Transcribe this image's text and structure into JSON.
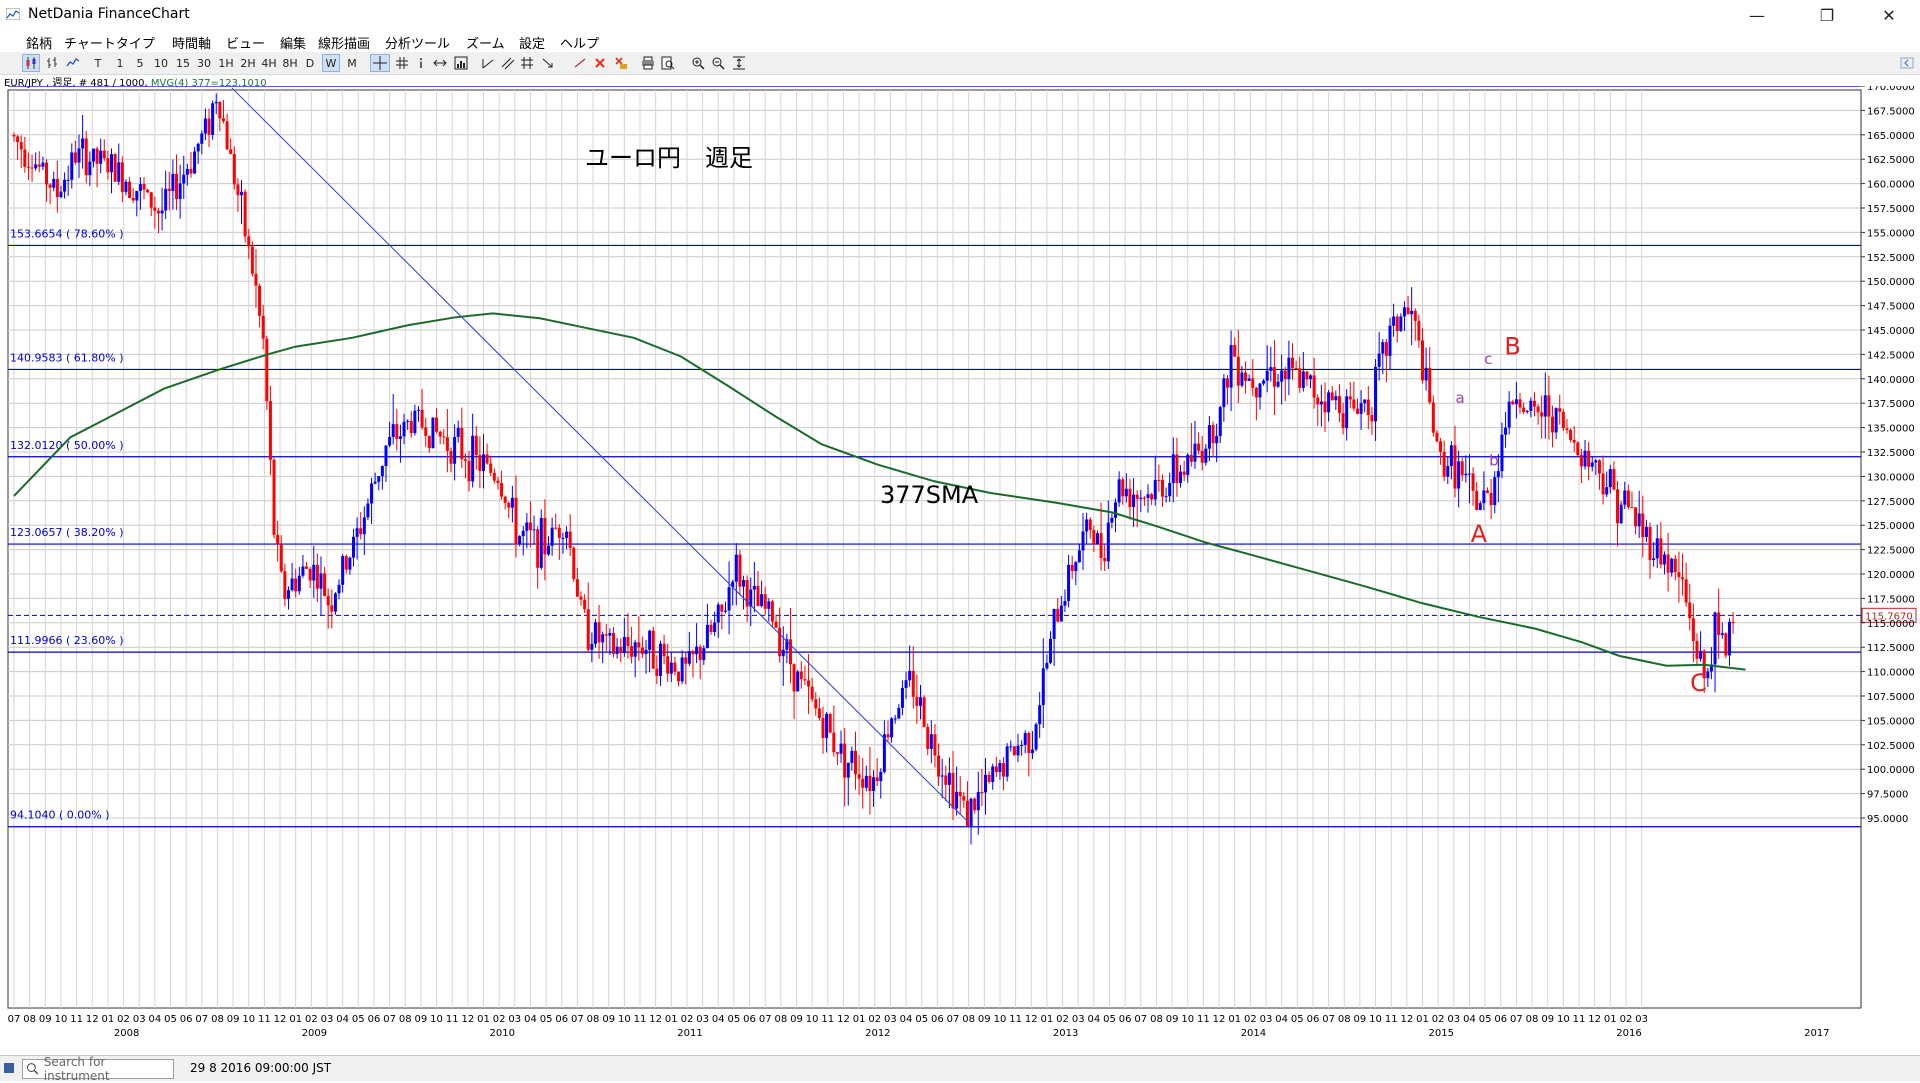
{
  "window": {
    "title": "NetDania FinanceChart",
    "minimize": "—",
    "maximize": "❐",
    "close": "✕"
  },
  "menu": [
    "銘柄",
    "チャートタイプ",
    "時間軸",
    "ビュー",
    "編集",
    "線形描画",
    "分析ツール",
    "ズーム",
    "設定",
    "ヘルプ"
  ],
  "toolbar": {
    "periods": [
      "T",
      "1",
      "5",
      "10",
      "15",
      "30",
      "1H",
      "2H",
      "4H",
      "8H",
      "D",
      "W",
      "M"
    ],
    "selected_period": "W"
  },
  "info": {
    "symbol_line": "EUR/JPY , 週足, # 481 / 1000,",
    "mvg_line": "MVG(4) 377=123.1010"
  },
  "status": {
    "search_placeholder": "Search for instrument",
    "datetime": "29 8 2016 09:00:00 JST"
  },
  "colors": {
    "up_candle": "#0000ff",
    "down_candle": "#ff0000",
    "sma": "#1a6b2a",
    "fib_lines": "#0000cc",
    "annotation_red": "#e02020",
    "annotation_purple": "#a040b0"
  },
  "chart_data": {
    "type": "candlestick",
    "instrument": "EUR/JPY",
    "timeframe": "週足",
    "annotation_title": "ユーロ円　週足",
    "sma_label": "377SMA",
    "y_axis": {
      "ylim": [
        94.5,
        171.0
      ],
      "ticks": [
        "170.0000",
        "167.5000",
        "165.0000",
        "162.5000",
        "160.0000",
        "157.5000",
        "155.0000",
        "152.5000",
        "150.0000",
        "147.5000",
        "145.0000",
        "142.5000",
        "140.0000",
        "137.5000",
        "135.0000",
        "132.5000",
        "130.0000",
        "127.5000",
        "125.0000",
        "122.5000",
        "120.0000",
        "117.5000",
        "115.0000",
        "112.5000",
        "110.0000",
        "107.5000",
        "105.0000",
        "102.5000",
        "100.0000",
        "97.5000",
        "95.0000"
      ]
    },
    "current_price": "115.7670",
    "current_value": 115.767,
    "fibonacci_levels": [
      {
        "value": 170.0,
        "label": ""
      },
      {
        "value": 153.6654,
        "label": "153.6654 ( 78.60% )"
      },
      {
        "value": 140.9583,
        "label": "140.9583 ( 61.80% )"
      },
      {
        "value": 132.012,
        "label": "132.0120 ( 50.00% )"
      },
      {
        "value": 123.0657,
        "label": "123.0657 ( 38.20% )"
      },
      {
        "value": 111.9966,
        "label": "111.9966 ( 23.60% )"
      },
      {
        "value": 94.104,
        "label": "94.1040 ( 0.00% )"
      }
    ],
    "x_axis": {
      "start": 2008.0,
      "end": 2017.25,
      "months": [
        "07",
        "08",
        "09",
        "10",
        "11",
        "12",
        "01",
        "02",
        "03",
        "04",
        "05",
        "06",
        "07",
        "08",
        "09",
        "10",
        "11",
        "12",
        "01",
        "02",
        "03",
        "04",
        "05",
        "06",
        "07",
        "08",
        "09",
        "10",
        "11",
        "12",
        "01",
        "02",
        "03",
        "04",
        "05",
        "06",
        "07",
        "08",
        "09",
        "10",
        "11",
        "12",
        "01",
        "02",
        "03",
        "04",
        "05",
        "06",
        "07",
        "08",
        "09",
        "10",
        "11",
        "12",
        "01",
        "02",
        "03",
        "04",
        "05",
        "06",
        "07",
        "08",
        "09",
        "10",
        "11",
        "12",
        "01",
        "02",
        "03",
        "04",
        "05",
        "06",
        "07",
        "08",
        "09",
        "10",
        "11",
        "12",
        "01",
        "02",
        "03",
        "04",
        "05",
        "06",
        "07",
        "08",
        "09",
        "10",
        "11",
        "12",
        "01",
        "02",
        "03",
        "04",
        "05",
        "06",
        "07",
        "08",
        "09",
        "10",
        "11",
        "12",
        "01",
        "02",
        "03"
      ],
      "years": [
        "2008",
        "2009",
        "2010",
        "2011",
        "2012",
        "2013",
        "2014",
        "2015",
        "2016",
        "2017"
      ]
    },
    "price_path": [
      [
        2007.5,
        165
      ],
      [
        2007.6,
        163
      ],
      [
        2007.75,
        159
      ],
      [
        2007.85,
        163
      ],
      [
        2008.0,
        162
      ],
      [
        2008.15,
        160
      ],
      [
        2008.3,
        157
      ],
      [
        2008.45,
        162
      ],
      [
        2008.55,
        166
      ],
      [
        2008.6,
        169.5
      ],
      [
        2008.7,
        160
      ],
      [
        2008.8,
        150
      ],
      [
        2008.85,
        143
      ],
      [
        2008.9,
        125
      ],
      [
        2008.95,
        118
      ],
      [
        2009.1,
        121
      ],
      [
        2009.2,
        117
      ],
      [
        2009.35,
        124
      ],
      [
        2009.5,
        133
      ],
      [
        2009.65,
        136
      ],
      [
        2009.8,
        134
      ],
      [
        2009.95,
        132
      ],
      [
        2010.1,
        130
      ],
      [
        2010.2,
        124
      ],
      [
        2010.35,
        123
      ],
      [
        2010.45,
        126
      ],
      [
        2010.55,
        115
      ],
      [
        2010.7,
        112
      ],
      [
        2010.85,
        113
      ],
      [
        2011.0,
        111
      ],
      [
        2011.1,
        110
      ],
      [
        2011.2,
        113
      ],
      [
        2011.3,
        116
      ],
      [
        2011.35,
        121
      ],
      [
        2011.45,
        117
      ],
      [
        2011.55,
        116
      ],
      [
        2011.7,
        109
      ],
      [
        2011.85,
        104
      ],
      [
        2011.95,
        101
      ],
      [
        2012.1,
        99
      ],
      [
        2012.2,
        106
      ],
      [
        2012.3,
        109
      ],
      [
        2012.4,
        103
      ],
      [
        2012.55,
        97
      ],
      [
        2012.6,
        95.5
      ],
      [
        2012.7,
        98
      ],
      [
        2012.8,
        101
      ],
      [
        2012.95,
        104
      ],
      [
        2013.05,
        114
      ],
      [
        2013.15,
        121
      ],
      [
        2013.25,
        125
      ],
      [
        2013.3,
        122
      ],
      [
        2013.4,
        129
      ],
      [
        2013.55,
        128
      ],
      [
        2013.7,
        130
      ],
      [
        2013.85,
        133
      ],
      [
        2013.95,
        137
      ],
      [
        2014.0,
        143
      ],
      [
        2014.1,
        140
      ],
      [
        2014.2,
        141
      ],
      [
        2014.35,
        140
      ],
      [
        2014.5,
        138
      ],
      [
        2014.65,
        137
      ],
      [
        2014.75,
        138
      ],
      [
        2014.85,
        145
      ],
      [
        2014.92,
        147
      ],
      [
        2014.97,
        146
      ],
      [
        2015.05,
        138
      ],
      [
        2015.1,
        132
      ],
      [
        2015.2,
        131
      ],
      [
        2015.3,
        127
      ],
      [
        2015.38,
        128
      ],
      [
        2015.45,
        135
      ],
      [
        2015.52,
        139
      ],
      [
        2015.58,
        136
      ],
      [
        2015.7,
        137
      ],
      [
        2015.8,
        134
      ],
      [
        2015.95,
        131
      ],
      [
        2016.05,
        128
      ],
      [
        2016.15,
        126
      ],
      [
        2016.2,
        124
      ],
      [
        2016.3,
        122
      ],
      [
        2016.4,
        119
      ],
      [
        2016.47,
        113
      ],
      [
        2016.52,
        109
      ],
      [
        2016.58,
        114
      ],
      [
        2016.63,
        112
      ],
      [
        2016.66,
        115.767
      ]
    ],
    "sma_path": [
      [
        2007.5,
        128
      ],
      [
        2007.8,
        134
      ],
      [
        2008.0,
        136
      ],
      [
        2008.3,
        139
      ],
      [
        2008.6,
        141
      ],
      [
        2008.85,
        142.5
      ],
      [
        2009.0,
        143.3
      ],
      [
        2009.3,
        144.2
      ],
      [
        2009.6,
        145.5
      ],
      [
        2009.85,
        146.3
      ],
      [
        2010.05,
        146.7
      ],
      [
        2010.3,
        146.2
      ],
      [
        2010.55,
        145.2
      ],
      [
        2010.8,
        144.2
      ],
      [
        2011.05,
        142.3
      ],
      [
        2011.3,
        139.3
      ],
      [
        2011.55,
        136.2
      ],
      [
        2011.8,
        133.3
      ],
      [
        2012.1,
        131.2
      ],
      [
        2012.4,
        129.5
      ],
      [
        2012.7,
        128.3
      ],
      [
        2013.05,
        127.3
      ],
      [
        2013.35,
        126.3
      ],
      [
        2013.6,
        124.8
      ],
      [
        2013.85,
        123.2
      ],
      [
        2014.1,
        121.9
      ],
      [
        2014.4,
        120.3
      ],
      [
        2014.7,
        118.7
      ],
      [
        2015.0,
        117.0
      ],
      [
        2015.3,
        115.6
      ],
      [
        2015.6,
        114.4
      ],
      [
        2015.85,
        113.0
      ],
      [
        2016.05,
        111.6
      ],
      [
        2016.3,
        110.6
      ],
      [
        2016.5,
        110.7
      ],
      [
        2016.72,
        110.2
      ]
    ],
    "trendline": {
      "from": [
        2008.66,
        169.8
      ],
      "to": [
        2012.58,
        94.6
      ]
    },
    "annotations": [
      {
        "text": "A",
        "x": 2015.3,
        "y": 123.3,
        "color": "#e02020",
        "size": "large"
      },
      {
        "text": "B",
        "x": 2015.48,
        "y": 142.5,
        "color": "#e02020",
        "size": "large"
      },
      {
        "text": "C",
        "x": 2016.47,
        "y": 108.0,
        "color": "#e02020",
        "size": "large"
      },
      {
        "text": "a",
        "x": 2015.2,
        "y": 137.5,
        "color": "#a040b0",
        "size": "small"
      },
      {
        "text": "b",
        "x": 2015.38,
        "y": 131.1,
        "color": "#a040b0",
        "size": "small"
      },
      {
        "text": "c",
        "x": 2015.35,
        "y": 141.5,
        "color": "#a040b0",
        "size": "small"
      }
    ]
  }
}
